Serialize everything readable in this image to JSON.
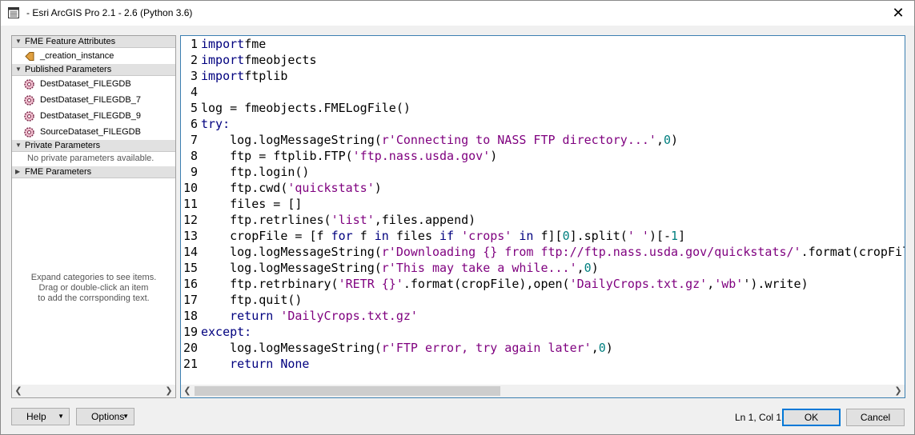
{
  "window": {
    "title": "- Esri ArcGIS Pro 2.1 - 2.6 (Python 3.6)"
  },
  "left_panel": {
    "categories": [
      {
        "label": "FME Feature Attributes",
        "items": [
          "_creation_instance"
        ]
      },
      {
        "label": "Published Parameters",
        "items": [
          "DestDataset_FILEGDB",
          "DestDataset_FILEGDB_7",
          "DestDataset_FILEGDB_9",
          "SourceDataset_FILEGDB"
        ]
      },
      {
        "label": "Private Parameters",
        "empty_text": "No private parameters available."
      },
      {
        "label": "FME Parameters"
      }
    ],
    "hint": [
      "Expand categories to see items.",
      "Drag or double-click an item",
      "to add the corrsponding text."
    ]
  },
  "editor": {
    "lines": [
      {
        "n": "1",
        "t": [
          [
            "kw",
            "import"
          ],
          [
            "",
            "fme"
          ]
        ]
      },
      {
        "n": "2",
        "t": [
          [
            "kw",
            "import"
          ],
          [
            "",
            "fmeobjects"
          ]
        ]
      },
      {
        "n": "3",
        "t": [
          [
            "kw",
            "import"
          ],
          [
            "",
            "ftplib"
          ]
        ]
      },
      {
        "n": "4",
        "t": []
      },
      {
        "n": "5",
        "t": [
          [
            "",
            "log = fmeobjects.FMELogFile()"
          ]
        ]
      },
      {
        "n": "6",
        "t": [
          [
            "kw",
            "try:"
          ]
        ]
      },
      {
        "n": "7",
        "t": [
          [
            "",
            "    log.logMessageString("
          ],
          [
            "str",
            "r'Connecting to NASS FTP directory...'"
          ],
          [
            "",
            ","
          ],
          [
            "num",
            "0"
          ],
          [
            "",
            ")"
          ]
        ]
      },
      {
        "n": "8",
        "t": [
          [
            "",
            "    ftp = ftplib.FTP("
          ],
          [
            "str",
            "'ftp.nass.usda.gov'"
          ],
          [
            "",
            ")"
          ]
        ]
      },
      {
        "n": "9",
        "t": [
          [
            "",
            "    ftp.login()"
          ]
        ]
      },
      {
        "n": "10",
        "t": [
          [
            "",
            "    ftp.cwd("
          ],
          [
            "str",
            "'quickstats'"
          ],
          [
            "",
            ")"
          ]
        ]
      },
      {
        "n": "11",
        "t": [
          [
            "",
            "    files = []"
          ]
        ]
      },
      {
        "n": "12",
        "t": [
          [
            "",
            "    ftp.retrlines("
          ],
          [
            "str",
            "'list'"
          ],
          [
            "",
            ",files.append)"
          ]
        ]
      },
      {
        "n": "13",
        "t": [
          [
            "",
            "    cropFile = [f "
          ],
          [
            "kw",
            "for"
          ],
          [
            "",
            " f "
          ],
          [
            "kw",
            "in"
          ],
          [
            "",
            " files "
          ],
          [
            "kw",
            "if"
          ],
          [
            "",
            " "
          ],
          [
            "str",
            "'crops'"
          ],
          [
            "",
            " "
          ],
          [
            "kw",
            "in"
          ],
          [
            "",
            " f]["
          ],
          [
            "num",
            "0"
          ],
          [
            "",
            "].split("
          ],
          [
            "str",
            "' '"
          ],
          [
            "",
            ")[-"
          ],
          [
            "num",
            "1"
          ],
          [
            "",
            "]"
          ]
        ]
      },
      {
        "n": "14",
        "t": [
          [
            "",
            "    log.logMessageString("
          ],
          [
            "str",
            "r'Downloading {} from ftp://ftp.nass.usda.gov/quickstats/'"
          ],
          [
            "",
            ".format(cropFil"
          ]
        ]
      },
      {
        "n": "15",
        "t": [
          [
            "",
            "    log.logMessageString("
          ],
          [
            "str",
            "r'This may take a while...'"
          ],
          [
            "",
            ","
          ],
          [
            "num",
            "0"
          ],
          [
            "",
            ")"
          ]
        ]
      },
      {
        "n": "16",
        "t": [
          [
            "",
            "    ftp.retrbinary("
          ],
          [
            "str",
            "'RETR {}'"
          ],
          [
            "",
            ".format(cropFile),open("
          ],
          [
            "str",
            "'DailyCrops.txt.gz'"
          ],
          [
            "",
            ","
          ],
          [
            "str",
            "'wb'"
          ],
          [
            "",
            "').write)"
          ]
        ]
      },
      {
        "n": "17",
        "t": [
          [
            "",
            "    ftp.quit()"
          ]
        ]
      },
      {
        "n": "18",
        "t": [
          [
            "",
            "    "
          ],
          [
            "kw",
            "return"
          ],
          [
            "",
            " "
          ],
          [
            "str",
            "'DailyCrops.txt.gz'"
          ]
        ]
      },
      {
        "n": "19",
        "t": [
          [
            "kw",
            "except:"
          ]
        ]
      },
      {
        "n": "20",
        "t": [
          [
            "",
            "    log.logMessageString("
          ],
          [
            "str",
            "r'FTP error, try again later'"
          ],
          [
            "",
            ","
          ],
          [
            "num",
            "0"
          ],
          [
            "",
            ")"
          ]
        ]
      },
      {
        "n": "21",
        "t": [
          [
            "",
            "    "
          ],
          [
            "kw",
            "return"
          ],
          [
            "",
            " "
          ],
          [
            "kw",
            "None"
          ]
        ]
      }
    ]
  },
  "footer": {
    "help_label": "Help",
    "options_label": "Options",
    "status": "Ln 1, Col 1",
    "ok_label": "OK",
    "cancel_label": "Cancel"
  },
  "colors": {
    "keyword": "#00007f",
    "string": "#7f007f",
    "number": "#007f7f",
    "focus": "#0078d7"
  }
}
